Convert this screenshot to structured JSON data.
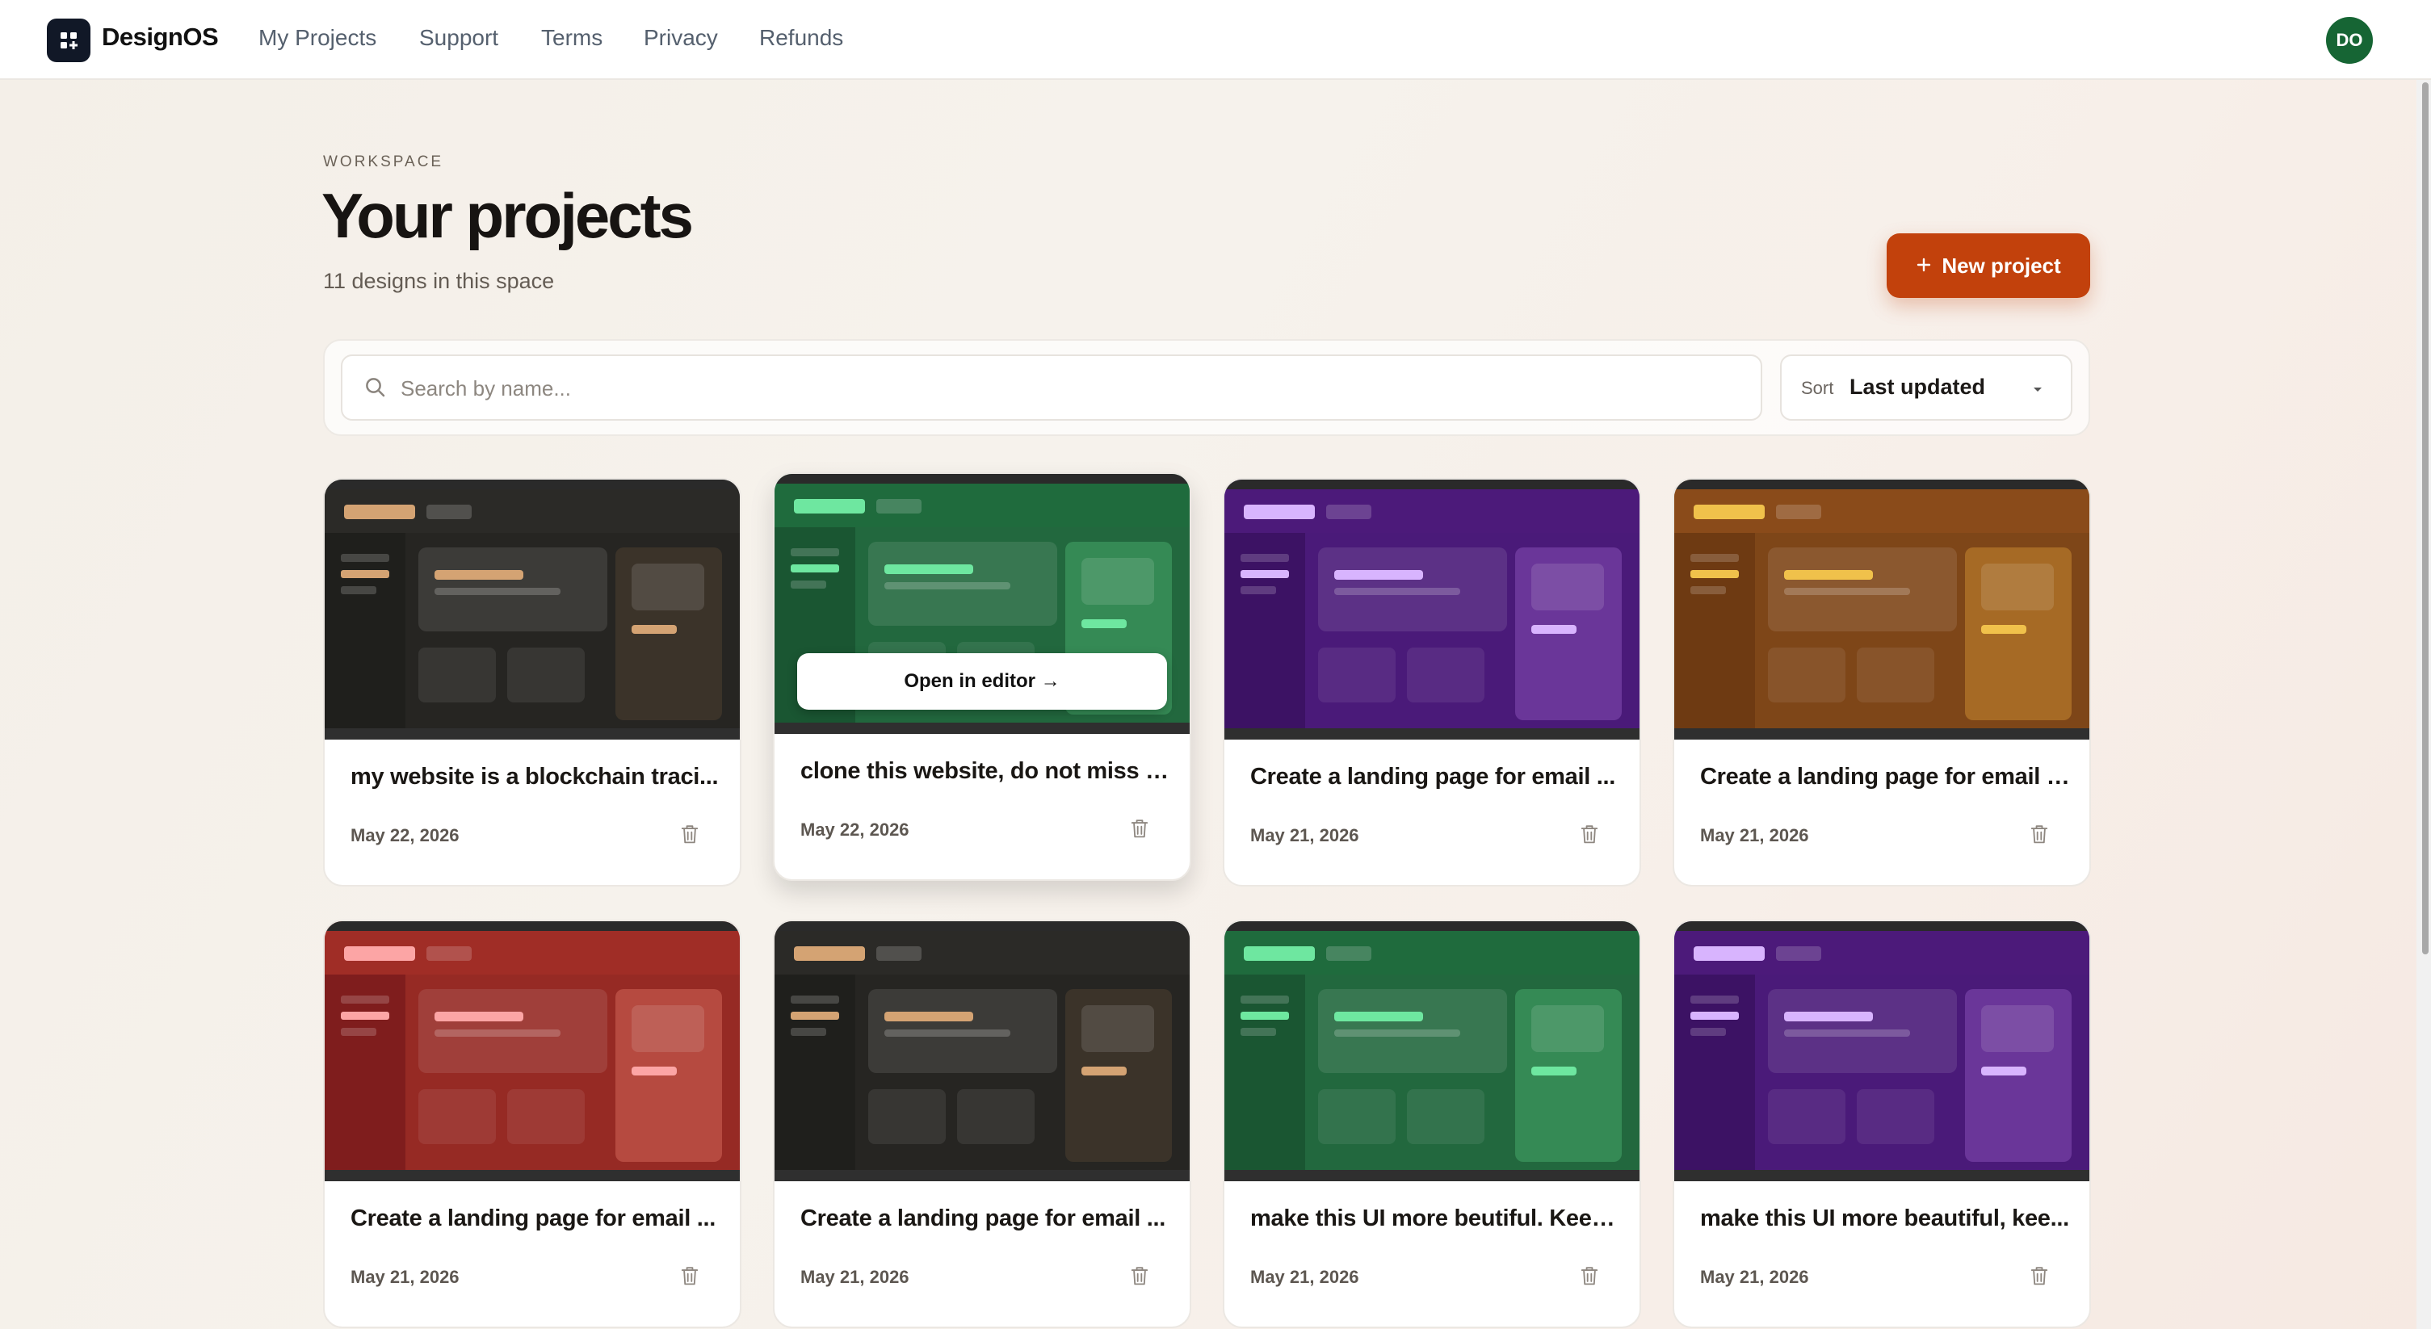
{
  "nav": {
    "brand": "DesignOS",
    "links": [
      "My Projects",
      "Support",
      "Terms",
      "Privacy",
      "Refunds"
    ],
    "avatar_initials": "DO"
  },
  "header": {
    "eyebrow": "WORKSPACE",
    "title": "Your projects",
    "subtitle": "11 designs in this space",
    "new_button": "New project"
  },
  "search": {
    "placeholder": "Search by name...",
    "sort_label": "Sort",
    "sort_value": "Last updated"
  },
  "hover_action": "Open in editor →",
  "projects": [
    {
      "title": "my website is a blockchain traci...",
      "date": "May 22, 2026",
      "theme": "charcoal"
    },
    {
      "title": "clone this website, do not miss a...",
      "date": "May 22, 2026",
      "theme": "green"
    },
    {
      "title": "Create a landing page for email ...",
      "date": "May 21, 2026",
      "theme": "purple"
    },
    {
      "title": "Create a landing page for email t...",
      "date": "May 21, 2026",
      "theme": "amber"
    },
    {
      "title": "Create a landing page for email ...",
      "date": "May 21, 2026",
      "theme": "red"
    },
    {
      "title": "Create a landing page for email ...",
      "date": "May 21, 2026",
      "theme": "charcoal"
    },
    {
      "title": "make this UI more beutiful. Keep...",
      "date": "May 21, 2026",
      "theme": "green"
    },
    {
      "title": "make this UI more beautiful, kee...",
      "date": "May 21, 2026",
      "theme": "purple"
    }
  ],
  "themes": {
    "charcoal": {
      "bar": "#2b2a27",
      "side": "#1f1f1c",
      "main": "#262522",
      "panel": "#34322e",
      "aside": "#3b3329",
      "accent": "#d4a373",
      "muted": "#4a4844"
    },
    "green": {
      "bar": "#1f6b3d",
      "side": "#1a5632",
      "main": "#22683e",
      "panel": "#2e7d4c",
      "aside": "#358a55",
      "accent": "#6ee7a0",
      "muted": "#3f8a5d"
    },
    "purple": {
      "bar": "#4c1a7a",
      "side": "#3c1264",
      "main": "#4a1a79",
      "panel": "#5b2a8c",
      "aside": "#6a3699",
      "accent": "#d8b4fe",
      "muted": "#6d3d9a"
    },
    "amber": {
      "bar": "#8a4b1a",
      "side": "#6e3a12",
      "main": "#7e4618",
      "panel": "#935924",
      "aside": "#a66a25",
      "accent": "#f0c14b",
      "muted": "#a06c3e"
    },
    "red": {
      "bar": "#a02d26",
      "side": "#7f1d1d",
      "main": "#962a24",
      "panel": "#ad3b33",
      "aside": "#b64a40",
      "accent": "#fca5a5",
      "muted": "#b85a52"
    }
  }
}
